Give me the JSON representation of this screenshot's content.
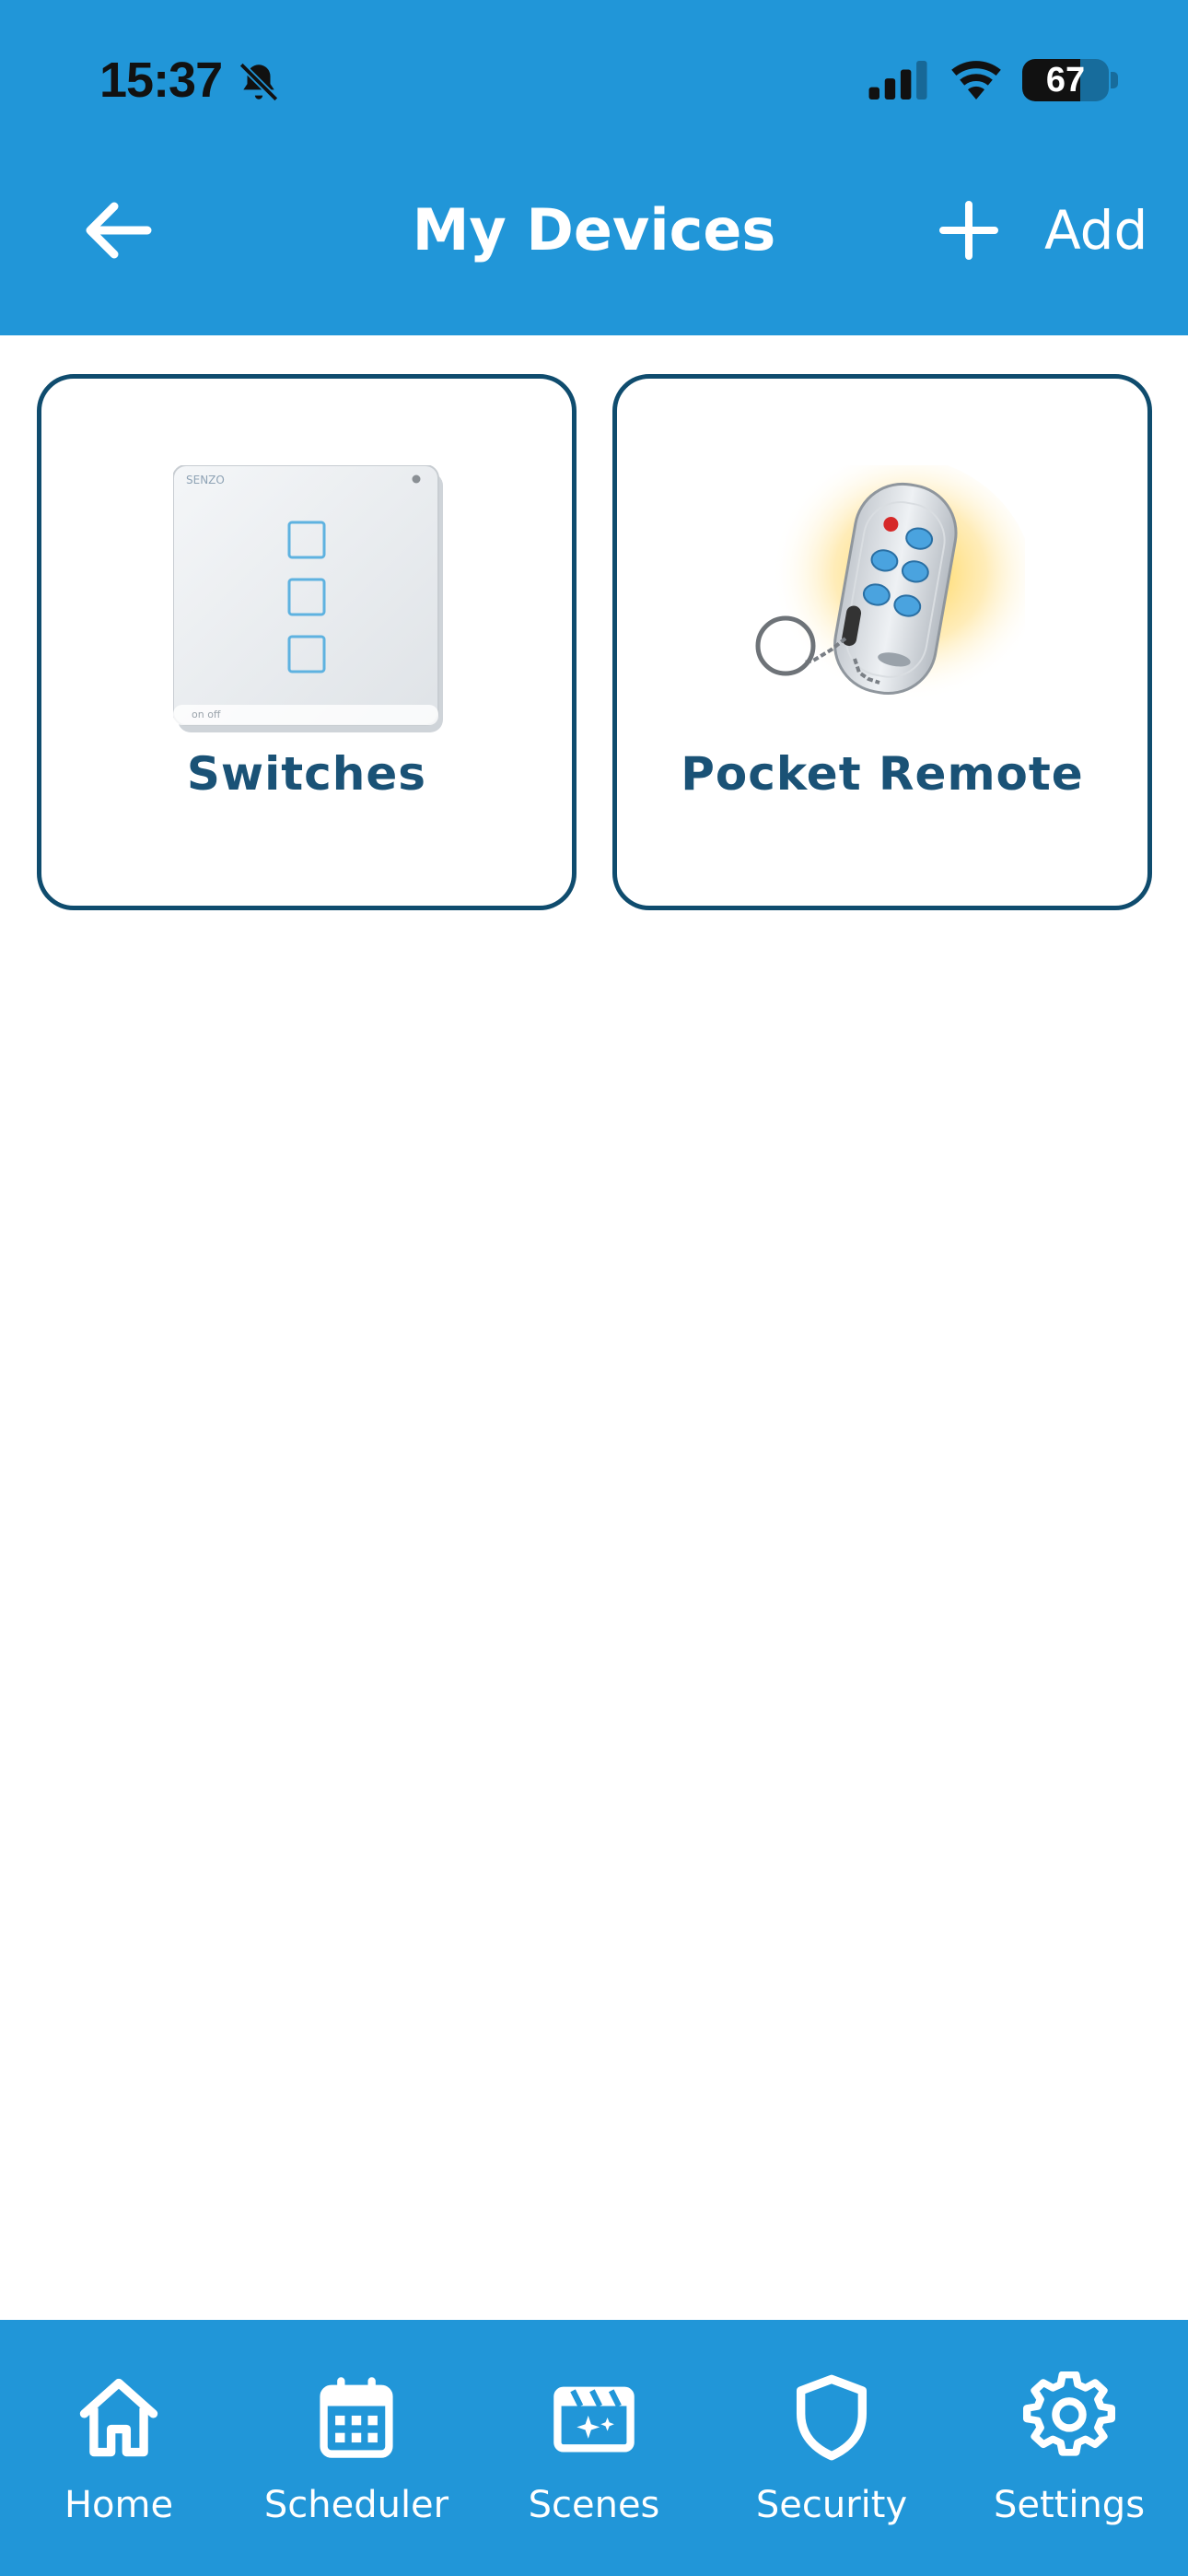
{
  "status_bar": {
    "time": "15:37",
    "battery": "67",
    "battery_level": 0.67,
    "icons": [
      "bell-slash-icon",
      "cellular-signal-icon",
      "wifi-icon",
      "battery-icon"
    ]
  },
  "nav": {
    "title": "My Devices",
    "back_icon": "arrow-left-icon",
    "add_icon": "plus-icon",
    "add_label": "Add"
  },
  "devices": [
    {
      "label": "Switches",
      "image": "wall-switch-image"
    },
    {
      "label": "Pocket Remote",
      "image": "keyfob-remote-image"
    }
  ],
  "switch_image": {
    "brand": "SENZO",
    "footer": "on   off"
  },
  "tabs": [
    {
      "label": "Home",
      "icon": "home-icon"
    },
    {
      "label": "Scheduler",
      "icon": "calendar-icon"
    },
    {
      "label": "Scenes",
      "icon": "clapperboard-icon"
    },
    {
      "label": "Security",
      "icon": "shield-icon"
    },
    {
      "label": "Settings",
      "icon": "gear-icon"
    }
  ],
  "colors": {
    "primary": "#2196d8",
    "card_border": "#0f4c6e",
    "card_text": "#1a5276",
    "tab_text": "#ffffff"
  }
}
